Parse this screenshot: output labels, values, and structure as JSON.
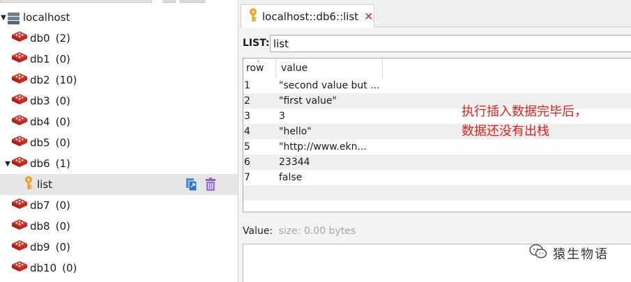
{
  "tree": {
    "server": {
      "label": "localhost",
      "expanded": true
    },
    "databases": [
      {
        "label": "db0",
        "count": "(2)"
      },
      {
        "label": "db1",
        "count": "(0)"
      },
      {
        "label": "db2",
        "count": "(10)"
      },
      {
        "label": "db3",
        "count": "(0)"
      },
      {
        "label": "db4",
        "count": "(0)"
      },
      {
        "label": "db5",
        "count": "(0)"
      },
      {
        "label": "db6",
        "count": "(1)",
        "expanded": true
      },
      {
        "label": "db7",
        "count": "(0)"
      },
      {
        "label": "db8",
        "count": "(0)"
      },
      {
        "label": "db9",
        "count": "(0)"
      },
      {
        "label": "db10",
        "count": "(0)"
      }
    ],
    "selected_key": {
      "label": "list",
      "icon": "key-icon"
    }
  },
  "tab": {
    "label": "localhost::db6::list",
    "close": "✕"
  },
  "key_view": {
    "type_label": "LIST:",
    "key_name": "list",
    "columns": [
      "row",
      "value"
    ],
    "rows": [
      {
        "row": "1",
        "value": "\"second value but ..."
      },
      {
        "row": "2",
        "value": "\"first value\""
      },
      {
        "row": "3",
        "value": "3"
      },
      {
        "row": "4",
        "value": "\"hello\""
      },
      {
        "row": "5",
        "value": "\"http://www.ekn..."
      },
      {
        "row": "6",
        "value": "23344"
      },
      {
        "row": "7",
        "value": "false"
      }
    ],
    "value_label": "Value:",
    "value_size": "size: 0.00 bytes"
  },
  "annotation": {
    "line1": "执行插入数据完毕后，",
    "line2": "数据还没有出栈",
    "color": "#e0201a"
  },
  "watermark": {
    "text": "猿生物语"
  },
  "colors": {
    "accent_red": "#d21c3a",
    "key_gold": "#f0a020",
    "selected_bg": "#e6e6e6"
  }
}
